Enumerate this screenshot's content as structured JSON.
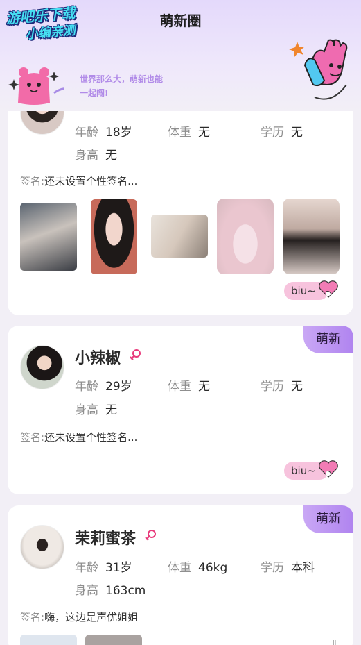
{
  "watermark": {
    "line1": "游吧乐下载",
    "line2": "小编亲测"
  },
  "header": {
    "title": "萌新圈",
    "slogan_line1": "世界那么大，萌新也能",
    "slogan_line2": "一起闯!"
  },
  "cards": [
    {
      "name": "",
      "stats": [
        {
          "label": "年龄",
          "value": "18岁"
        },
        {
          "label": "体重",
          "value": "无"
        },
        {
          "label": "学历",
          "value": "无"
        },
        {
          "label": "身高",
          "value": "无"
        }
      ],
      "signature_label": "签名:",
      "signature": "还未设置个性签名...",
      "photos": 5,
      "biu": "biu~"
    },
    {
      "badge": "萌新",
      "name": "小辣椒",
      "stats": [
        {
          "label": "年龄",
          "value": "29岁"
        },
        {
          "label": "体重",
          "value": "无"
        },
        {
          "label": "学历",
          "value": "无"
        },
        {
          "label": "身高",
          "value": "无"
        }
      ],
      "signature_label": "签名:",
      "signature": "还未设置个性签名...",
      "biu": "biu~"
    },
    {
      "badge": "萌新",
      "name": "茉莉蜜茶",
      "stats": [
        {
          "label": "年龄",
          "value": "31岁"
        },
        {
          "label": "体重",
          "value": "46kg"
        },
        {
          "label": "学历",
          "value": "本科"
        },
        {
          "label": "身高",
          "value": "163cm"
        }
      ],
      "signature_label": "签名:",
      "signature": "嗨，这边是声优姐姐"
    }
  ],
  "colors": {
    "accent": "#b084ef",
    "gender": "#e8397a",
    "biu_pill": "#f7c3dd"
  },
  "icons": {
    "gender": "female-symbol-icon",
    "biu": "heart-hand-icon"
  }
}
